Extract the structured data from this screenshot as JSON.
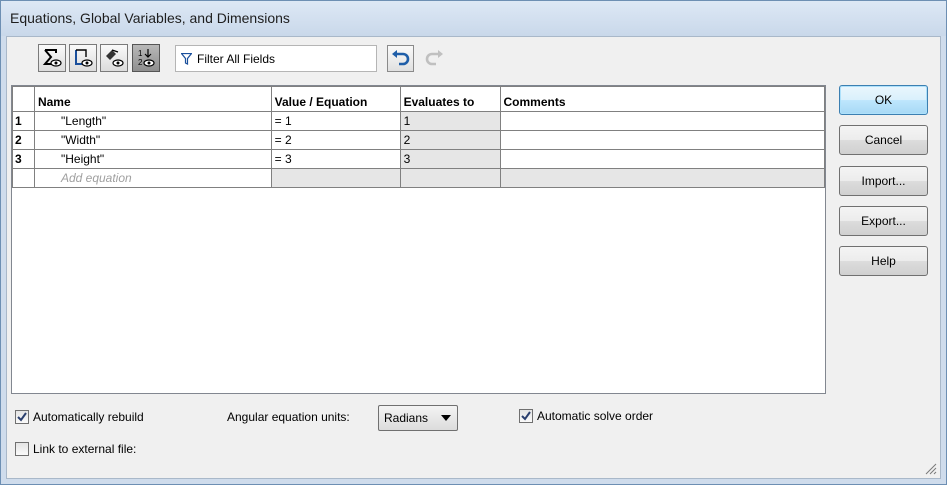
{
  "window": {
    "title": "Equations, Global Variables, and Dimensions"
  },
  "toolbar": {
    "buttons": [
      {
        "icon": "sigma-eye-icon",
        "tooltip": ""
      },
      {
        "icon": "sheet-eye-icon",
        "tooltip": ""
      },
      {
        "icon": "tag-eye-icon",
        "tooltip": ""
      },
      {
        "icon": "ordered-view-icon",
        "tooltip": ""
      }
    ],
    "filter_placeholder": "Filter All Fields",
    "undo_icon": "undo-icon",
    "redo_icon": "redo-icon"
  },
  "table": {
    "headers": [
      "Name",
      "Value / Equation",
      "Evaluates to",
      "Comments"
    ],
    "rows": [
      {
        "num": "1",
        "name": "\"Length\"",
        "value": "= 1",
        "evaluates": "1",
        "comment": ""
      },
      {
        "num": "2",
        "name": "\"Width\"",
        "value": "= 2",
        "evaluates": "2",
        "comment": ""
      },
      {
        "num": "3",
        "name": "\"Height\"",
        "value": "= 3",
        "evaluates": "3",
        "comment": ""
      }
    ],
    "add_placeholder": "Add equation"
  },
  "buttons": {
    "ok": "OK",
    "cancel": "Cancel",
    "import": "Import...",
    "export": "Export...",
    "help": "Help"
  },
  "options": {
    "auto_rebuild": {
      "label": "Automatically rebuild",
      "checked": true
    },
    "angular_label": "Angular equation units:",
    "angular_value": "Radians",
    "auto_solve": {
      "label": "Automatic solve order",
      "checked": true
    },
    "link_external": {
      "label": "Link to external file:",
      "checked": false
    }
  }
}
